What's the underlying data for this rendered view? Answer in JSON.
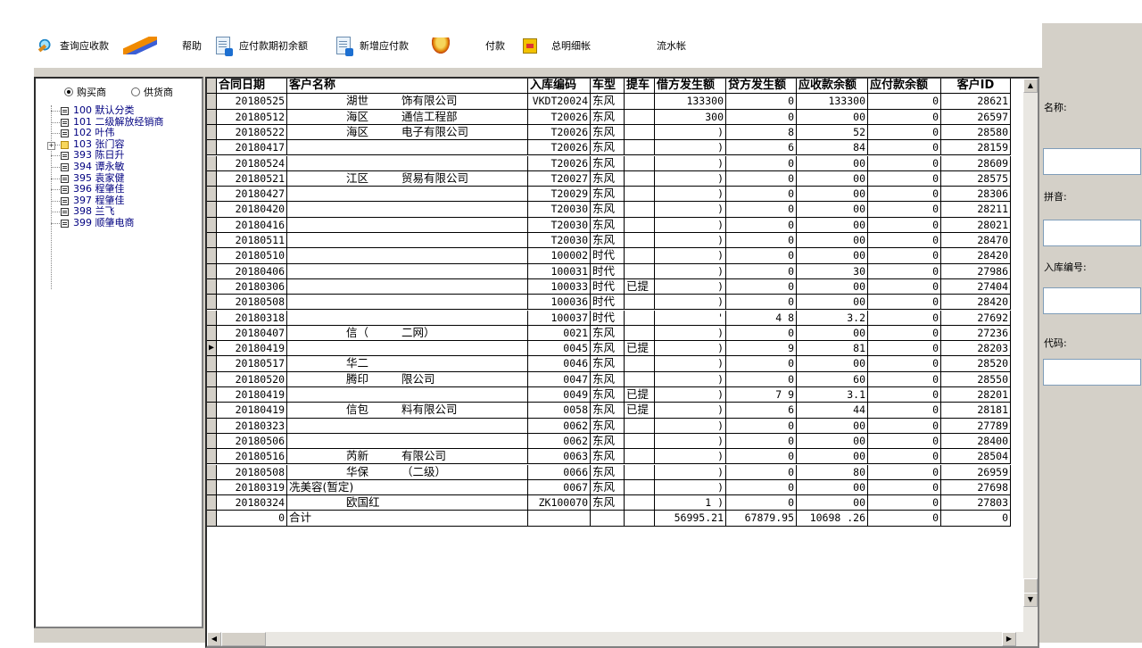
{
  "toolbar": {
    "query_receivable": "查询应收款",
    "help": "帮助",
    "payable_opening_balance": "应付款期初余额",
    "add_payable": "新增应付款",
    "payment": "付款",
    "total_detail": "总明细帐",
    "journal": "流水帐"
  },
  "filter": {
    "buyer": "购买商",
    "supplier": "供货商",
    "selected": "buyer"
  },
  "tree": {
    "items": [
      {
        "label": "100 默认分类",
        "type": "file"
      },
      {
        "label": "101 二级解放经销商",
        "type": "file"
      },
      {
        "label": "102 叶伟",
        "type": "file"
      },
      {
        "label": "103 张门容",
        "type": "folder",
        "expander": "+"
      },
      {
        "label": "393 陈日升",
        "type": "file"
      },
      {
        "label": "394 谭永敏",
        "type": "file"
      },
      {
        "label": "395 袁家健",
        "type": "file"
      },
      {
        "label": "396 程肇佳",
        "type": "file"
      },
      {
        "label": "397 程肇佳",
        "type": "file"
      },
      {
        "label": "398 兰飞",
        "type": "file"
      },
      {
        "label": "399 顺肇电商",
        "type": "file"
      }
    ]
  },
  "grid": {
    "columns": [
      "合同日期",
      "客户名称",
      "入库编码",
      "车型",
      "提车",
      "借方发生额",
      "贷方发生额",
      "应收款余额",
      "应付款余额",
      "客户ID"
    ],
    "current_row_marker": "▶",
    "rows": [
      {
        "date": "20180525",
        "n1": "湖世",
        "n2": "饰有限公司",
        "code": "VKDT20024",
        "model": "东风",
        "pick": "",
        "debit": "133300",
        "credit": "0",
        "recv": "133300",
        "pay": "0",
        "id": "28621"
      },
      {
        "date": "20180512",
        "n1": "海区",
        "n2": "通信工程部",
        "code": "T20026",
        "model": "东风",
        "pick": "",
        "debit": "300",
        "credit": "0",
        "recv": "00",
        "pay": "0",
        "id": "26597"
      },
      {
        "date": "20180522",
        "n1": "海区",
        "n2": "电子有限公司",
        "code": "T20026",
        "model": "东风",
        "pick": "",
        "debit": ")",
        "credit": "8",
        "recv": "52",
        "pay": "0",
        "id": "28580"
      },
      {
        "date": "20180417",
        "n1": "",
        "n2": "",
        "code": "T20026",
        "model": "东风",
        "pick": "",
        "debit": ")",
        "credit": "6",
        "recv": "84",
        "pay": "0",
        "id": "28159"
      },
      {
        "date": "20180524",
        "n1": "",
        "n2": "",
        "code": "T20026",
        "model": "东风",
        "pick": "",
        "debit": ")",
        "credit": "0",
        "recv": "00",
        "pay": "0",
        "id": "28609"
      },
      {
        "date": "20180521",
        "n1": "江区",
        "n2": "贸易有限公司",
        "code": "T20027",
        "model": "东风",
        "pick": "",
        "debit": ")",
        "credit": "0",
        "recv": "00",
        "pay": "0",
        "id": "28575"
      },
      {
        "date": "20180427",
        "n1": "",
        "n2": "",
        "code": "T20029",
        "model": "东风",
        "pick": "",
        "debit": ")",
        "credit": "0",
        "recv": "00",
        "pay": "0",
        "id": "28306"
      },
      {
        "date": "20180420",
        "n1": "",
        "n2": "",
        "code": "T20030",
        "model": "东风",
        "pick": "",
        "debit": ")",
        "credit": "0",
        "recv": "00",
        "pay": "0",
        "id": "28211"
      },
      {
        "date": "20180416",
        "n1": "",
        "n2": "",
        "code": "T20030",
        "model": "东风",
        "pick": "",
        "debit": ")",
        "credit": "0",
        "recv": "00",
        "pay": "0",
        "id": "28021"
      },
      {
        "date": "20180511",
        "n1": "",
        "n2": "",
        "code": "T20030",
        "model": "东风",
        "pick": "",
        "debit": ")",
        "credit": "0",
        "recv": "00",
        "pay": "0",
        "id": "28470"
      },
      {
        "date": "20180510",
        "n1": "",
        "n2": "",
        "code": "100002",
        "model": "时代",
        "pick": "",
        "debit": ")",
        "credit": "0",
        "recv": "00",
        "pay": "0",
        "id": "28420"
      },
      {
        "date": "20180406",
        "n1": "",
        "n2": "",
        "code": "100031",
        "model": "时代",
        "pick": "",
        "debit": ")",
        "credit": "0",
        "recv": "30",
        "pay": "0",
        "id": "27986"
      },
      {
        "date": "20180306",
        "n1": "",
        "n2": "",
        "code": "100033",
        "model": "时代",
        "pick": "已提",
        "debit": ")",
        "credit": "0",
        "recv": "00",
        "pay": "0",
        "id": "27404"
      },
      {
        "date": "20180508",
        "n1": "",
        "n2": "",
        "code": "100036",
        "model": "时代",
        "pick": "",
        "debit": ")",
        "credit": "0",
        "recv": "00",
        "pay": "0",
        "id": "28420"
      },
      {
        "date": "20180318",
        "n1": "",
        "n2": "",
        "code": "100037",
        "model": "时代",
        "pick": "",
        "debit": "'",
        "credit": "4  8",
        "recv": "3.2",
        "pay": "0",
        "id": "27692"
      },
      {
        "date": "20180407",
        "n1": "信（",
        "n2": "二网）",
        "code": "0021",
        "model": "东风",
        "pick": "",
        "debit": ")",
        "credit": "0",
        "recv": "00",
        "pay": "0",
        "id": "27236"
      },
      {
        "date": "20180419",
        "n1": "",
        "n2": "",
        "code": "0045",
        "model": "东风",
        "pick": "已提",
        "debit": ")",
        "credit": "9",
        "recv": "81",
        "pay": "0",
        "id": "28203"
      },
      {
        "date": "20180517",
        "n1": "华二",
        "n2": "",
        "code": "0046",
        "model": "东风",
        "pick": "",
        "debit": ")",
        "credit": "0",
        "recv": "00",
        "pay": "0",
        "id": "28520"
      },
      {
        "date": "20180520",
        "n1": "腾印",
        "n2": "限公司",
        "code": "0047",
        "model": "东风",
        "pick": "",
        "debit": ")",
        "credit": "0",
        "recv": "60",
        "pay": "0",
        "id": "28550"
      },
      {
        "date": "20180419",
        "n1": "",
        "n2": "",
        "code": "0049",
        "model": "东风",
        "pick": "已提",
        "debit": ")",
        "credit": "7  9",
        "recv": "3.1",
        "pay": "0",
        "id": "28201"
      },
      {
        "date": "20180419",
        "n1": "信包",
        "n2": "料有限公司",
        "code": "0058",
        "model": "东风",
        "pick": "已提",
        "debit": ")",
        "credit": "6",
        "recv": "44",
        "pay": "0",
        "id": "28181"
      },
      {
        "date": "20180323",
        "n1": "",
        "n2": "",
        "code": "0062",
        "model": "东风",
        "pick": "",
        "debit": ")",
        "credit": "0",
        "recv": "00",
        "pay": "0",
        "id": "27789"
      },
      {
        "date": "20180506",
        "n1": "",
        "n2": "",
        "code": "0062",
        "model": "东风",
        "pick": "",
        "debit": ")",
        "credit": "0",
        "recv": "00",
        "pay": "0",
        "id": "28400"
      },
      {
        "date": "20180516",
        "n1": "芮新",
        "n2": "有限公司",
        "code": "0063",
        "model": "东风",
        "pick": "",
        "debit": ")",
        "credit": "0",
        "recv": "00",
        "pay": "0",
        "id": "28504"
      },
      {
        "date": "20180508",
        "n1": "华保",
        "n2": "（二级）",
        "code": "0066",
        "model": "东风",
        "pick": "",
        "debit": ")",
        "credit": "0",
        "recv": "80",
        "pay": "0",
        "id": "26959"
      },
      {
        "date": "20180319",
        "n1": "冼美容(暂定)",
        "n2": "",
        "code": "0067",
        "model": "东风",
        "pick": "",
        "debit": ")",
        "credit": "0",
        "recv": "00",
        "pay": "0",
        "id": "27698"
      },
      {
        "date": "20180324",
        "n1": "欧国红",
        "n2": "",
        "code": "ZK100070",
        "model": "东风",
        "pick": "",
        "debit": "1     )",
        "credit": "0",
        "recv": "00",
        "pay": "0",
        "id": "27803"
      }
    ],
    "total": {
      "date": "0",
      "label": "合计",
      "debit": "56995.21",
      "credit": "67879.95",
      "recv": "10698   .26",
      "pay": "0",
      "id": "0"
    }
  },
  "form": {
    "name_label": "名称:",
    "pinyin_label": "拼音:",
    "inbound_code_label": "入库编号:",
    "code_label": "代码:"
  }
}
